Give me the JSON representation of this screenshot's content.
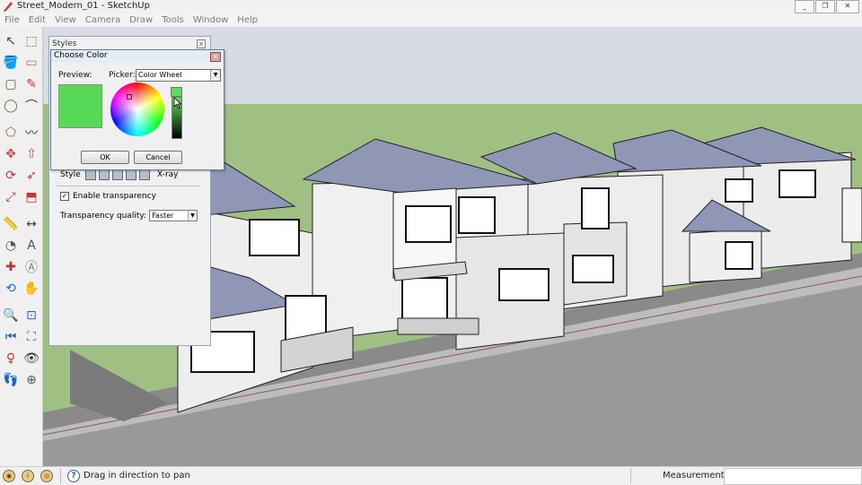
{
  "window": {
    "title": "Street_Modern_01 - SketchUp",
    "minimize": "_",
    "restore": "❐",
    "close": "✕"
  },
  "menu": [
    "File",
    "Edit",
    "View",
    "Camera",
    "Draw",
    "Tools",
    "Window",
    "Help"
  ],
  "toolbar_icons": [
    "select-icon",
    "make-component-icon",
    "paint-bucket-icon",
    "eraser-icon",
    "rectangle-icon",
    "line-icon",
    "circle-icon",
    "arc-icon",
    "polygon-icon",
    "freehand-icon",
    "move-icon",
    "push-pull-icon",
    "rotate-icon",
    "follow-me-icon",
    "scale-icon",
    "offset-icon",
    "tape-measure-icon",
    "dimension-icon",
    "protractor-icon",
    "text-icon",
    "axes-icon",
    "3d-text-icon",
    "orbit-icon",
    "pan-icon",
    "zoom-icon",
    "zoom-window-icon",
    "previous-view-icon",
    "zoom-extents-icon",
    "position-camera-icon",
    "look-around-icon",
    "walk-icon",
    "section-plane-icon"
  ],
  "styles_panel": {
    "header": "Styles",
    "style_label": "Style",
    "xray_label": "X-ray",
    "enable_transparency": "Enable transparency",
    "transparency_quality_label": "Transparency quality:",
    "transparency_quality_value": "Faster"
  },
  "choose_color": {
    "title": "Choose Color",
    "preview_label": "Preview:",
    "picker_label": "Picker:",
    "picker_value": "Color Wheel",
    "ok": "OK",
    "cancel": "Cancel",
    "current_color": "#58da58"
  },
  "status": {
    "hint": "Drag in direction to pan",
    "measurements_label": "Measurements",
    "measurements_value": ""
  },
  "colors": {
    "sky": "#d6dbe4",
    "grass": "#9fbf83",
    "road": "#9a9a9a",
    "roof": "#8f96b6",
    "wall": "#f0f0f0"
  }
}
